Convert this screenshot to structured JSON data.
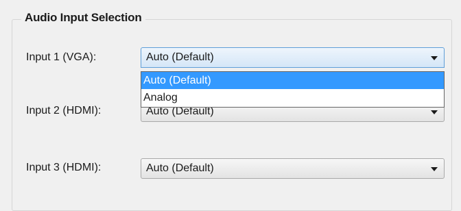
{
  "group": {
    "title": "Audio Input Selection"
  },
  "inputs": [
    {
      "label": "Input 1 (VGA):",
      "value": "Auto (Default)"
    },
    {
      "label": "Input 2 (HDMI):",
      "value": "Auto (Default)"
    },
    {
      "label": "Input 3 (HDMI):",
      "value": "Auto (Default)"
    }
  ],
  "dropdown": {
    "options": [
      "Auto (Default)",
      "Analog"
    ],
    "highlighted": "Auto (Default)"
  },
  "colors": {
    "highlight": "#3399ff",
    "window_bg": "#f0f0f0"
  },
  "icons": {
    "combo_arrow": "triangle-down"
  }
}
